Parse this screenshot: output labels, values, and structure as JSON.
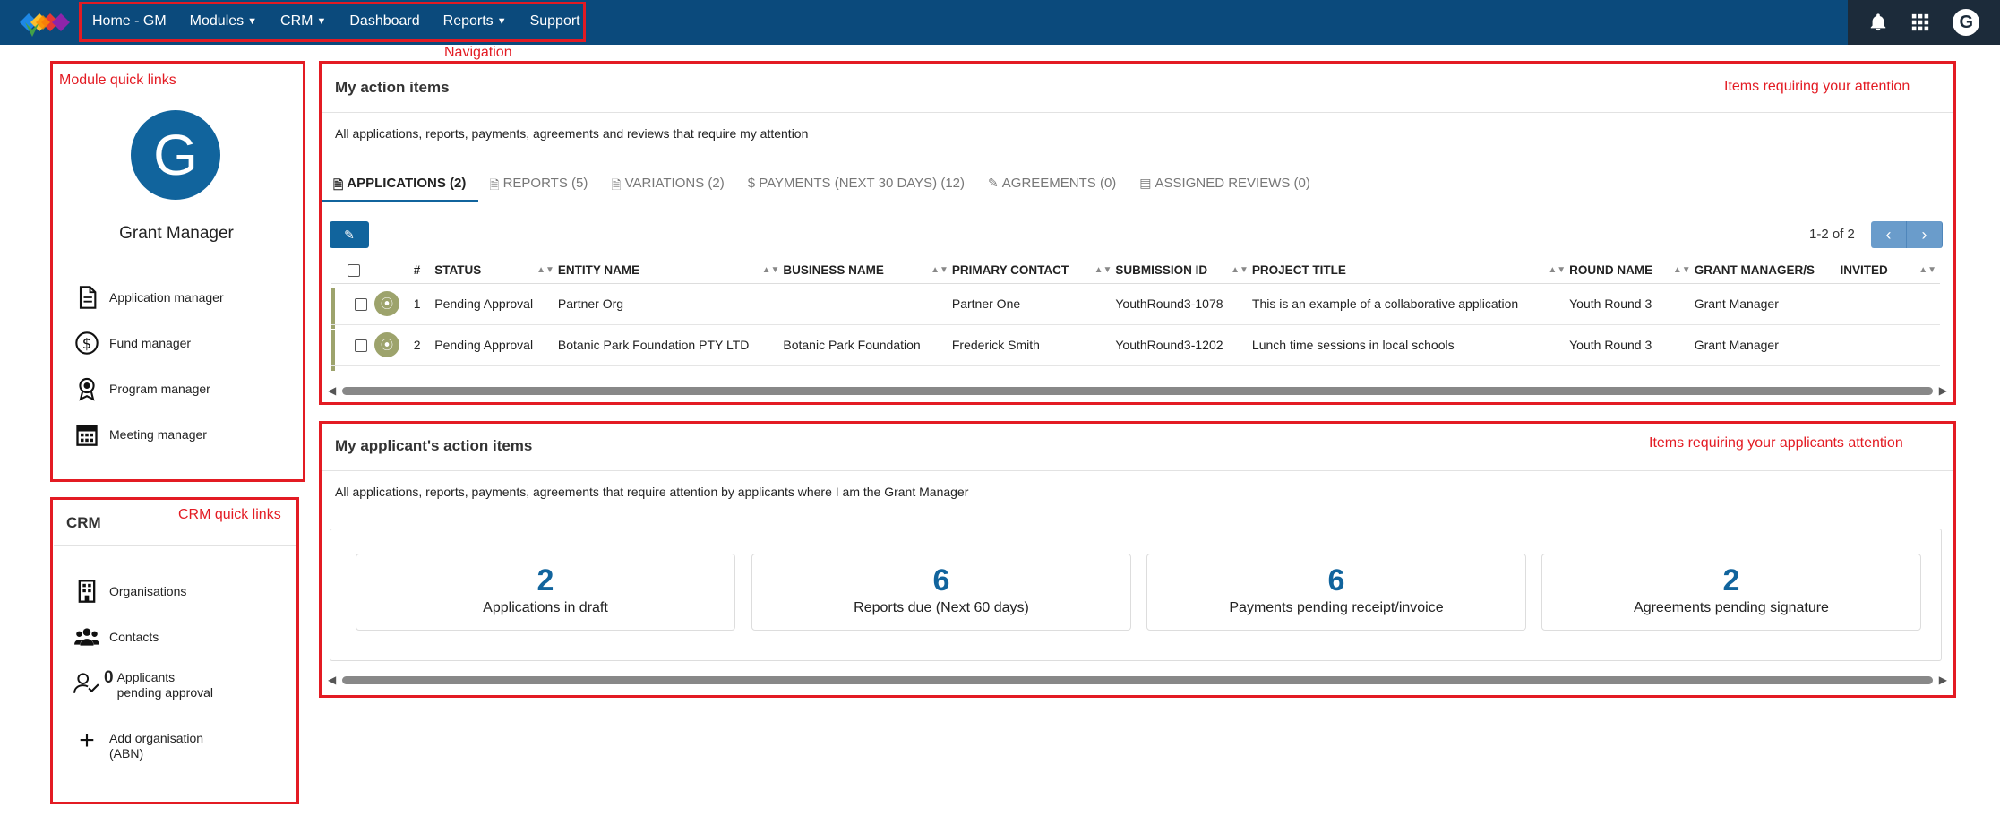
{
  "nav": {
    "items": [
      {
        "label": "Home - GM",
        "caret": false
      },
      {
        "label": "Modules",
        "caret": true
      },
      {
        "label": "CRM",
        "caret": true
      },
      {
        "label": "Dashboard",
        "caret": false
      },
      {
        "label": "Reports",
        "caret": true
      },
      {
        "label": "Support",
        "caret": false
      }
    ],
    "avatar_letter": "G"
  },
  "annotations": {
    "navigation": "Navigation",
    "module_quick_links": "Module quick links",
    "crm_quick_links": "CRM quick links",
    "items_attention": "Items requiring your attention",
    "items_applicants_attention": "Items requiring your applicants attention"
  },
  "modules": {
    "avatar_letter": "G",
    "role": "Grant Manager",
    "links": [
      {
        "label": "Application manager",
        "icon": "document-icon"
      },
      {
        "label": "Fund manager",
        "icon": "dollar-circle-icon"
      },
      {
        "label": "Program manager",
        "icon": "award-icon"
      },
      {
        "label": "Meeting manager",
        "icon": "calendar-icon"
      }
    ]
  },
  "crm": {
    "title": "CRM",
    "organisations": "Organisations",
    "contacts": "Contacts",
    "pending_count": "0",
    "pending_label_1": "Applicants",
    "pending_label_2": "pending approval",
    "add_org_1": "Add organisation",
    "add_org_2": "(ABN)"
  },
  "action_items": {
    "title": "My action items",
    "description": "All applications, reports, payments, agreements and reviews that require my attention",
    "tabs": [
      {
        "label": "APPLICATIONS (2)",
        "icon": "pdf-icon",
        "active": true
      },
      {
        "label": "REPORTS (5)",
        "icon": "report-icon",
        "active": false
      },
      {
        "label": "VARIATIONS (2)",
        "icon": "variation-icon",
        "active": false
      },
      {
        "label": "$ PAYMENTS (NEXT 30 DAYS) (12)",
        "icon": "",
        "active": false
      },
      {
        "label": "AGREEMENTS (0)",
        "icon": "signature-icon",
        "active": false
      },
      {
        "label": "ASSIGNED REVIEWS (0)",
        "icon": "reviews-icon",
        "active": false
      }
    ],
    "pager_text": "1-2 of 2",
    "columns": [
      "#",
      "STATUS",
      "ENTITY NAME",
      "BUSINESS NAME",
      "PRIMARY CONTACT",
      "SUBMISSION ID",
      "PROJECT TITLE",
      "ROUND NAME",
      "GRANT MANAGER/S",
      "INVITED"
    ],
    "rows": [
      {
        "num": "1",
        "status": "Pending Approval",
        "entity": "Partner Org",
        "business": "",
        "contact": "Partner One",
        "submission": "YouthRound3-1078",
        "project": "This is an example of a collaborative application",
        "round": "Youth Round 3",
        "manager": "Grant Manager",
        "invited": ""
      },
      {
        "num": "2",
        "status": "Pending Approval",
        "entity": "Botanic Park Foundation PTY LTD",
        "business": "Botanic Park Foundation",
        "contact": "Frederick Smith",
        "submission": "YouthRound3-1202",
        "project": "Lunch time sessions in local schools",
        "round": "Youth Round 3",
        "manager": "Grant Manager",
        "invited": ""
      }
    ]
  },
  "applicant_items": {
    "title": "My applicant's action items",
    "description": "All applications, reports, payments, agreements that require attention by applicants where I am the Grant Manager",
    "stats": [
      {
        "value": "2",
        "label": "Applications in draft"
      },
      {
        "value": "6",
        "label": "Reports due (Next 60 days)"
      },
      {
        "value": "6",
        "label": "Payments pending receipt/invoice"
      },
      {
        "value": "2",
        "label": "Agreements pending signature"
      }
    ]
  },
  "colors": {
    "topbar": "#0b4a7c",
    "accent": "#11649d",
    "annotation_red": "#e31b23",
    "status_green": "#9da36c"
  }
}
